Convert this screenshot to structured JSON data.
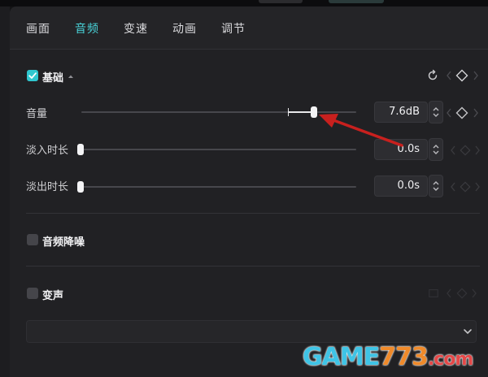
{
  "tabs": [
    {
      "label": "画面"
    },
    {
      "label": "音频"
    },
    {
      "label": "变速"
    },
    {
      "label": "动画"
    },
    {
      "label": "调节"
    }
  ],
  "active_tab": "音频",
  "basic": {
    "title": "基础",
    "enabled": true,
    "reset_icon": "reset-icon",
    "keyframe_icon": "diamond-keyframe-icon"
  },
  "volume": {
    "label": "音量",
    "value_text": "7.6dB",
    "slider_level": 0.855
  },
  "fade_in": {
    "label": "淡入时长",
    "value_text": "0.0s",
    "slider_level": 0.0
  },
  "fade_out": {
    "label": "淡出时长",
    "value_text": "0.0s",
    "slider_level": 0.0
  },
  "noise_reduction": {
    "title": "音频降噪",
    "enabled": false
  },
  "voice_change": {
    "title": "变声",
    "enabled": false
  },
  "watermark": {
    "text_game": "GAME",
    "text_num": "773",
    "text_com": ".com"
  },
  "colors": {
    "accent": "#49d2d8",
    "checkbox_on": "#2fc7cf",
    "arrow": "#c8201e"
  }
}
